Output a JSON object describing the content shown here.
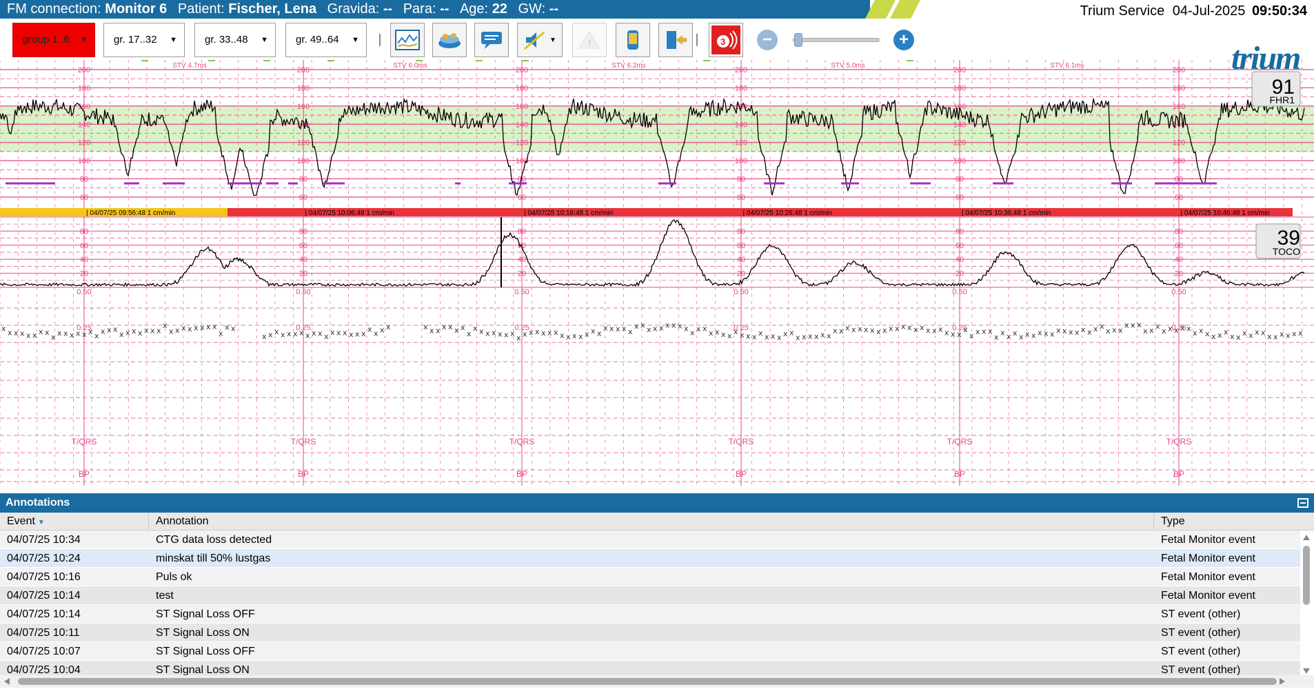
{
  "header": {
    "fm_label": "FM connection:",
    "monitor": "Monitor 6",
    "patient_label": "Patient:",
    "patient": "Fischer, Lena",
    "gravida_label": "Gravida:",
    "gravida": "--",
    "para_label": "Para:",
    "para": "--",
    "age_label": "Age:",
    "age": "22",
    "gw_label": "GW:",
    "gw": "--",
    "user": "Trium Service",
    "date": "04-Jul-2025",
    "time": "09:50:34",
    "bar_color": "#1a6ca0"
  },
  "toolbar": {
    "groups": [
      "group 1..6",
      "gr. 17..32",
      "gr. 33..48",
      "gr. 49..64"
    ],
    "logo_text": "trium",
    "zoom_level": 0.05,
    "icons": [
      "trend-icon",
      "layers-icon",
      "comment-icon",
      "alarm-mute-icon",
      "warning-icon",
      "device-icon",
      "exit-icon",
      "alarm-badge-icon"
    ],
    "alarm_badge_count": "3"
  },
  "chart": {
    "fhr_value": "91",
    "fhr_label": "FHR1",
    "toco_value": "39",
    "toco_label": "TOCO",
    "fhr_ticks": [
      "200",
      "180",
      "160",
      "140",
      "120",
      "100",
      "80",
      "60"
    ],
    "toco_ticks": [
      "80",
      "60",
      "40",
      "20",
      "0.50",
      "0.25"
    ],
    "stv_labels": [
      "STV 4.7ms",
      "STV 6.0ms",
      "STV 6.2ms",
      "STV 5.0ms",
      "STV 6.1ms"
    ],
    "time_labels": [
      "04/07/25 09:56:48",
      "04/07/25 10:06:48",
      "04/07/25 10:16:48",
      "04/07/25 10:26:48",
      "04/07/25 10:36:48",
      "04/07/25 10:46:48"
    ],
    "speed_label": "1 cm/min",
    "tqrs_label": "T/QRS",
    "bp_label": "BP",
    "grid_color": "#e8448a",
    "normal_band_color": "#d9f2c8",
    "band_yellow": "#f5c518",
    "band_red": "#e8333a"
  },
  "annotations": {
    "title": "Annotations",
    "columns": [
      "Event",
      "Annotation",
      "Type"
    ],
    "rows": [
      {
        "event": "04/07/25 10:34",
        "annotation": "CTG data loss detected",
        "type": "Fetal Monitor event"
      },
      {
        "event": "04/07/25 10:24",
        "annotation": "minskat till 50% lustgas",
        "type": "Fetal Monitor event"
      },
      {
        "event": "04/07/25 10:16",
        "annotation": "Puls ok",
        "type": "Fetal Monitor event"
      },
      {
        "event": "04/07/25 10:14",
        "annotation": "test",
        "type": "Fetal Monitor event"
      },
      {
        "event": "04/07/25 10:14",
        "annotation": "ST Signal Loss OFF",
        "type": "ST event (other)"
      },
      {
        "event": "04/07/25 10:11",
        "annotation": "ST Signal Loss ON",
        "type": "ST event (other)"
      },
      {
        "event": "04/07/25 10:07",
        "annotation": "ST Signal Loss OFF",
        "type": "ST event (other)"
      },
      {
        "event": "04/07/25 10:04",
        "annotation": "ST Signal Loss ON",
        "type": "ST event (other)"
      }
    ]
  }
}
